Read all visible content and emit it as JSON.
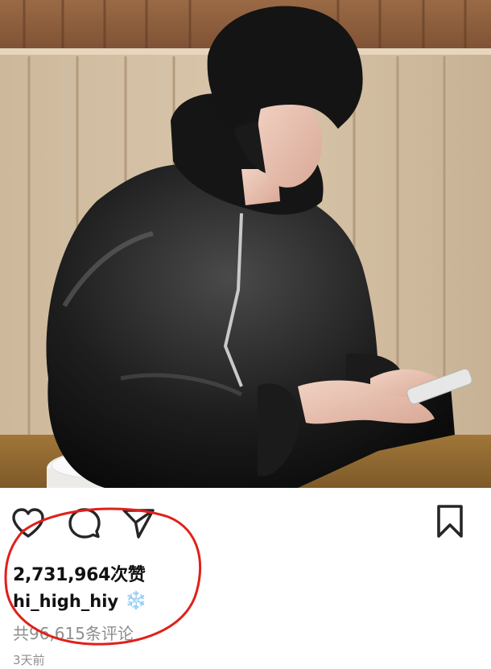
{
  "post": {
    "likes": "2,731,964次赞",
    "username": "hi_high_hiy",
    "caption_emoji": "❄️",
    "comments_link": "共96,615条评论",
    "time_ago": "3天前"
  },
  "icons": {
    "like": "heart-icon",
    "comment": "comment-bubble-icon",
    "share": "paper-plane-icon",
    "save": "bookmark-icon"
  },
  "colors": {
    "text": "#262626",
    "secondary": "#8e8e8e",
    "annotation": "#e0201b"
  }
}
